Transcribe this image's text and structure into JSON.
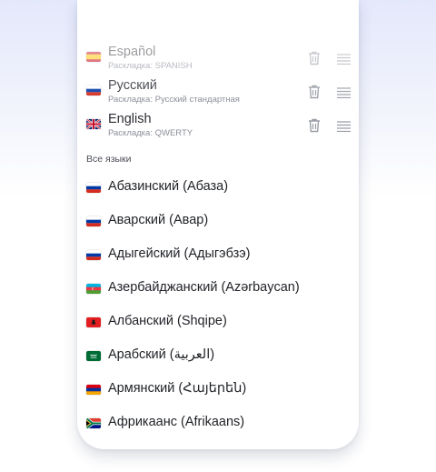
{
  "enabled_languages": [
    {
      "name": "Español",
      "layout": "Раскладка: SPANISH",
      "flag": "es"
    },
    {
      "name": "Русский",
      "layout": "Раскладка: Русский стандартная",
      "flag": "ru"
    },
    {
      "name": "English",
      "layout": "Раскладка: QWERTY",
      "flag": "gb"
    }
  ],
  "icons": {
    "delete": "trash-icon",
    "reorder": "drag-handle-icon"
  },
  "all_languages_title": "Все языки",
  "all_languages": [
    {
      "name": "Абазинский (Абаза)",
      "flag": "ru"
    },
    {
      "name": "Аварский (Авар)",
      "flag": "ru"
    },
    {
      "name": "Адыгейский (Адыгэбзэ)",
      "flag": "ru"
    },
    {
      "name": "Азербайджанский (Azərbaycan)",
      "flag": "az"
    },
    {
      "name": "Албанский (Shqipe)",
      "flag": "al"
    },
    {
      "name": "Арабский (العربية)",
      "flag": "sa"
    },
    {
      "name": "Армянский (Հայերեն)",
      "flag": "am"
    },
    {
      "name": "Африкаанс (Afrikaans)",
      "flag": "za"
    }
  ],
  "colors": {
    "icon_gray": "#9a9da6",
    "text_dark": "#1f2126",
    "subtitle": "#8c8f99"
  }
}
